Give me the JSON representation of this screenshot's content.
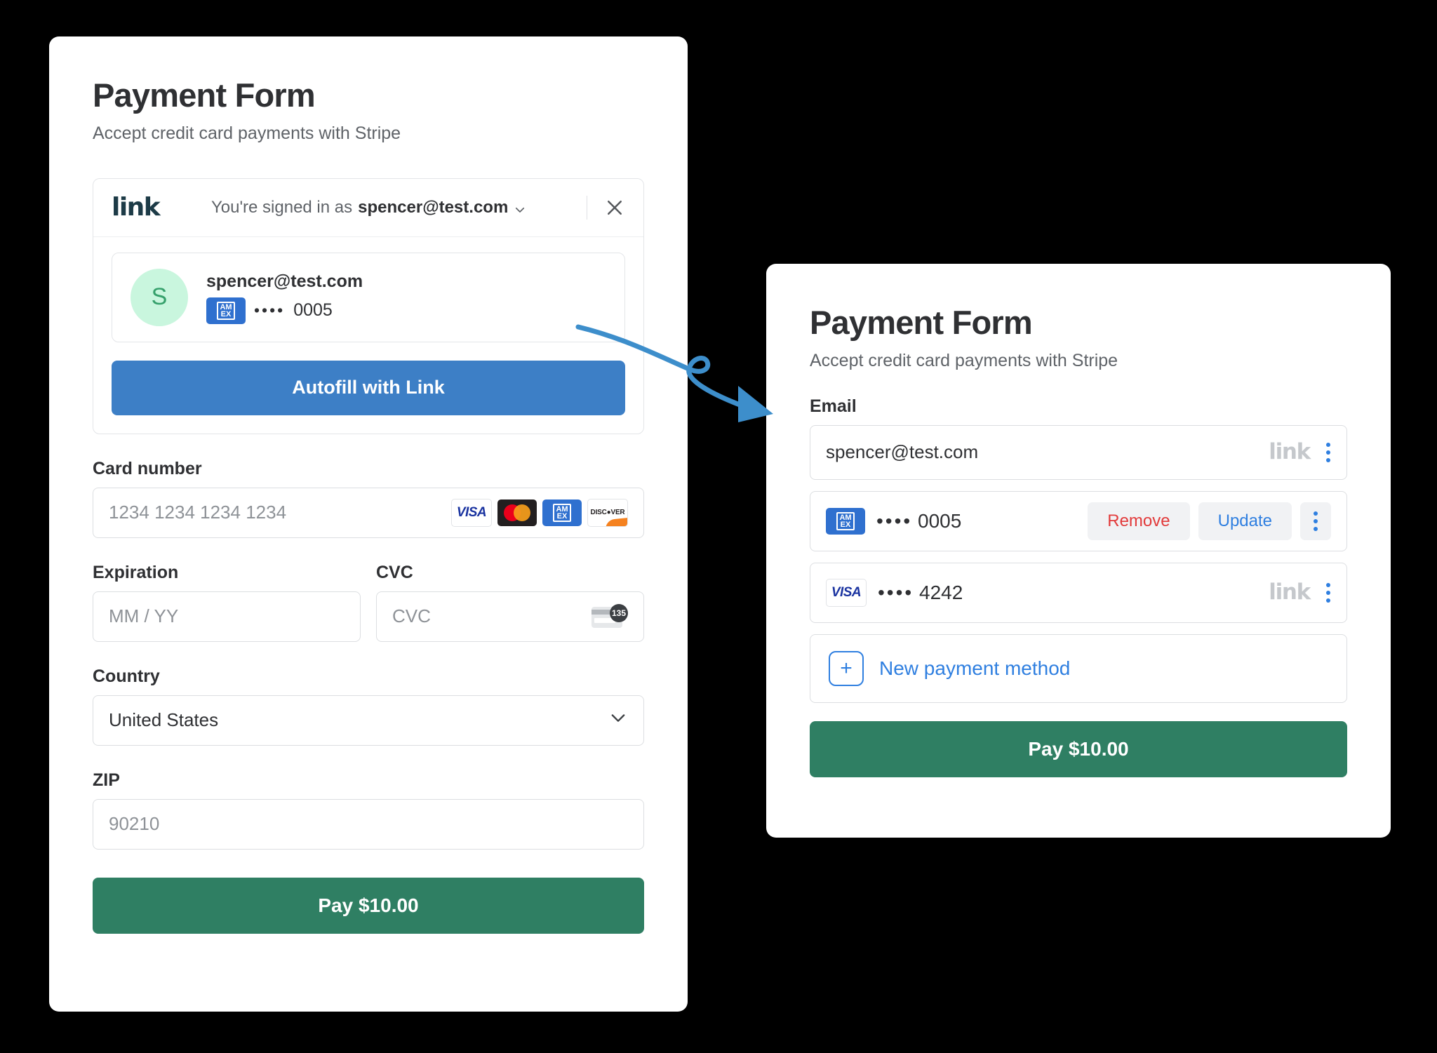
{
  "left_panel": {
    "title": "Payment Form",
    "subtitle": "Accept credit card payments with Stripe",
    "link_banner": {
      "logo_text": "link",
      "signed_in_prefix": "You're signed in as",
      "signed_in_email": "spencer@test.com",
      "chevron_icon": "chevron-down-icon",
      "close_icon": "close-icon",
      "account": {
        "avatar_initial": "S",
        "email": "spencer@test.com",
        "card_brand": "amex",
        "card_dots": "••••",
        "card_last4": "0005"
      },
      "autofill_label": "Autofill with Link"
    },
    "card_number": {
      "label": "Card number",
      "placeholder": "1234 1234 1234 1234",
      "value": "",
      "brands": [
        "visa",
        "mastercard",
        "amex",
        "discover"
      ]
    },
    "expiration": {
      "label": "Expiration",
      "placeholder": "MM / YY",
      "value": ""
    },
    "cvc": {
      "label": "CVC",
      "placeholder": "CVC",
      "value": "",
      "hint_badge": "135"
    },
    "country": {
      "label": "Country",
      "value": "United States",
      "chevron_icon": "chevron-down-icon"
    },
    "zip": {
      "label": "ZIP",
      "placeholder": "90210",
      "value": ""
    },
    "pay_label": "Pay $10.00"
  },
  "right_panel": {
    "title": "Payment Form",
    "subtitle": "Accept credit card payments with Stripe",
    "email_field": {
      "label": "Email",
      "value": "spencer@test.com",
      "link_mark": "link",
      "kebab_icon": "kebab-menu-icon"
    },
    "payment_methods": [
      {
        "brand": "amex",
        "dots": "••••",
        "last4": "0005",
        "remove_label": "Remove",
        "update_label": "Update",
        "kebab_icon": "kebab-menu-icon",
        "link_mark": ""
      },
      {
        "brand": "visa",
        "dots": "••••",
        "last4": "4242",
        "remove_label": "",
        "update_label": "",
        "kebab_icon": "kebab-menu-icon",
        "link_mark": "link"
      }
    ],
    "new_payment_method_label": "New payment method",
    "plus_icon": "plus-icon",
    "pay_label": "Pay $10.00"
  },
  "annotation": {
    "arrow_icon": "curved-arrow-icon",
    "arrow_color": "#3d8ecb"
  },
  "colors": {
    "background": "#000000",
    "panel": "#ffffff",
    "primary_blue": "#3d7fc6",
    "link_blue": "#2f7fe0",
    "pay_green": "#2f7f63",
    "remove_red": "#e23b3b",
    "avatar_green_bg": "#c9f6de",
    "avatar_green_fg": "#35a06b",
    "text_dark": "#2f3033",
    "text_muted": "#5f6368",
    "placeholder": "#8e9297",
    "border": "#dcdee1"
  }
}
